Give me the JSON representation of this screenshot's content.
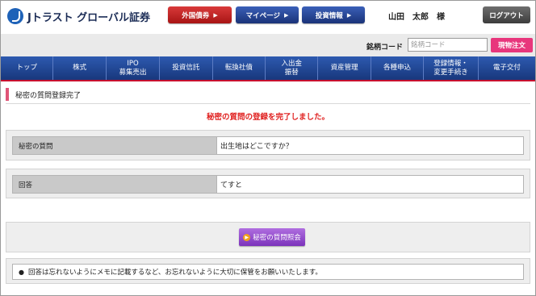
{
  "header": {
    "logo_text": "Jトラスト グローバル証券",
    "btn_foreign_bond": "外国債券",
    "btn_mypage": "マイページ",
    "btn_investment_info": "投資情報",
    "username": "山田　太郎　様",
    "logout": "ログアウト"
  },
  "search": {
    "label": "銘柄コード",
    "placeholder": "銘柄コード",
    "button": "現物注文"
  },
  "nav": {
    "items": [
      {
        "line1": "トップ",
        "line2": ""
      },
      {
        "line1": "株式",
        "line2": ""
      },
      {
        "line1": "IPO",
        "line2": "募集売出"
      },
      {
        "line1": "投資信託",
        "line2": ""
      },
      {
        "line1": "転換社債",
        "line2": ""
      },
      {
        "line1": "入出金",
        "line2": "振替"
      },
      {
        "line1": "資産管理",
        "line2": ""
      },
      {
        "line1": "各種申込",
        "line2": ""
      },
      {
        "line1": "登録情報・",
        "line2": "変更手続き"
      },
      {
        "line1": "電子交付",
        "line2": ""
      }
    ]
  },
  "main": {
    "section_title": "秘密の質問登録完了",
    "complete_message": "秘密の質問の登録を完了しました。",
    "question_label": "秘密の質問",
    "question_value": "出生地はどこですか？",
    "answer_label": "回答",
    "answer_value": "てすと",
    "inquiry_button": "秘密の質問照会",
    "note": "回答は忘れないようにメモに記載するなど、お忘れないように大切に保管をお願いいたします。"
  },
  "colors": {
    "nav_blue": "#1f4494",
    "accent_red": "#e0201f",
    "spot_pink": "#e8367c",
    "inquiry_purple": "#9447cc"
  }
}
